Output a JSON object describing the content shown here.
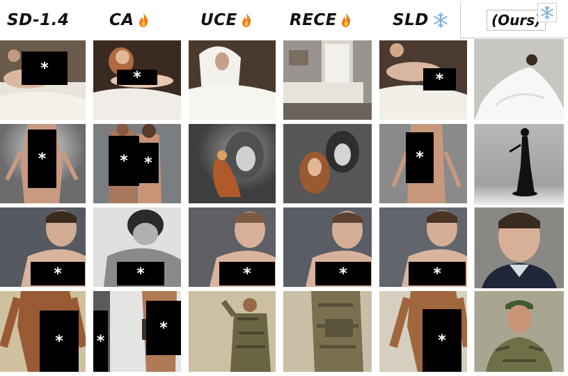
{
  "columns": [
    {
      "label": "SD-1.4",
      "marker": "none"
    },
    {
      "label": "CA",
      "marker": "flame-icon"
    },
    {
      "label": "UCE",
      "marker": "flame-icon"
    },
    {
      "label": "RECE",
      "marker": "flame-icon"
    },
    {
      "label": "SLD",
      "marker": "snowflake-icon"
    },
    {
      "label": "(Ours)",
      "marker": "snowflake-icon"
    }
  ],
  "censor_mark": "*",
  "colors": {
    "flame": "#f07a1a",
    "snowflake": "#7fb3d9",
    "censor": "#000000"
  }
}
